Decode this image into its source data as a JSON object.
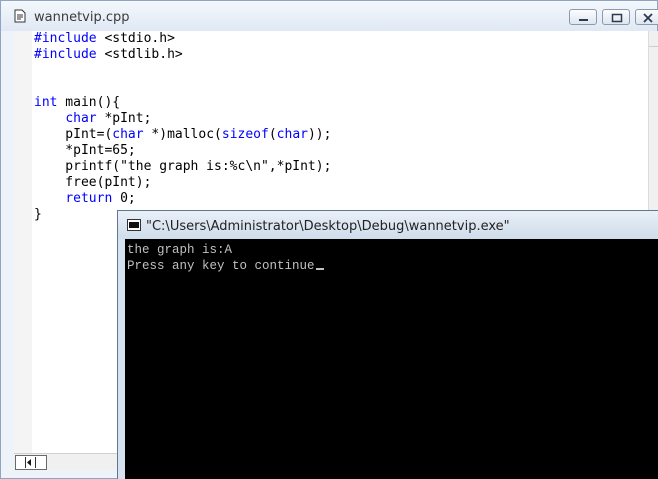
{
  "editor": {
    "title": "wannetvip.cpp",
    "code_lines": [
      [
        {
          "t": "#include",
          "kw": true
        },
        {
          "t": " <stdio.h>"
        }
      ],
      [
        {
          "t": "#include",
          "kw": true
        },
        {
          "t": " <stdlib.h>"
        }
      ],
      [
        {
          "t": ""
        }
      ],
      [
        {
          "t": ""
        }
      ],
      [
        {
          "t": "int",
          "kw": true
        },
        {
          "t": " main(){"
        }
      ],
      [
        {
          "t": "    "
        },
        {
          "t": "char",
          "kw": true
        },
        {
          "t": " *pInt;"
        }
      ],
      [
        {
          "t": "    pInt=("
        },
        {
          "t": "char",
          "kw": true
        },
        {
          "t": " *)malloc("
        },
        {
          "t": "sizeof",
          "kw": true
        },
        {
          "t": "("
        },
        {
          "t": "char",
          "kw": true
        },
        {
          "t": "));"
        }
      ],
      [
        {
          "t": "    *pInt=65;"
        }
      ],
      [
        {
          "t": "    printf(\"the graph is:%c\\n\",*pInt);"
        }
      ],
      [
        {
          "t": "    free(pInt);"
        }
      ],
      [
        {
          "t": "    "
        },
        {
          "t": "return",
          "kw": true
        },
        {
          "t": " 0;"
        }
      ],
      [
        {
          "t": "}"
        }
      ]
    ]
  },
  "console": {
    "title": "\"C:\\Users\\Administrator\\Desktop\\Debug\\wannetvip.exe\"",
    "output_line1": "the graph is:A",
    "output_line2": "Press any key to continue"
  },
  "colors": {
    "keyword": "#0000ff",
    "console_bg": "#000000",
    "console_text": "#c0c0c0"
  },
  "icons": {
    "doc": "document-icon",
    "console": "console-app-icon",
    "minimize": "minimize-icon",
    "maximize": "maximize-icon",
    "close": "close-icon"
  }
}
